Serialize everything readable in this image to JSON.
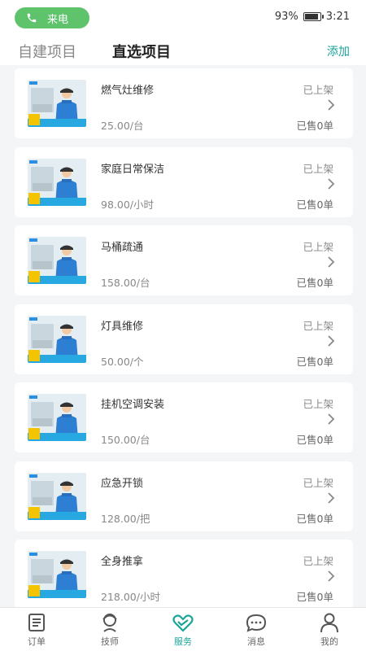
{
  "status_bar": {
    "call_label": "来电",
    "battery_text": "93%",
    "battery_level": 0.93,
    "time": "3:21"
  },
  "tabs": {
    "self_built": "自建项目",
    "selected": "直选项目",
    "add": "添加"
  },
  "services": [
    {
      "name": "燃气灶维修",
      "price": "25.00/台",
      "status": "已上架",
      "sold": "已售0单",
      "thumb_icon": "gas-stove-repair-thumbnail"
    },
    {
      "name": "家庭日常保洁",
      "price": "98.00/小时",
      "status": "已上架",
      "sold": "已售0单",
      "thumb_icon": "home-cleaning-thumbnail"
    },
    {
      "name": "马桶疏通",
      "price": "158.00/台",
      "status": "已上架",
      "sold": "已售0单",
      "thumb_icon": "toilet-unclog-thumbnail"
    },
    {
      "name": "灯具维修",
      "price": "50.00/个",
      "status": "已上架",
      "sold": "已售0单",
      "thumb_icon": "lamp-repair-thumbnail"
    },
    {
      "name": "挂机空调安装",
      "price": "150.00/台",
      "status": "已上架",
      "sold": "已售0单",
      "thumb_icon": "ac-install-thumbnail"
    },
    {
      "name": "应急开锁",
      "price": "128.00/把",
      "status": "已上架",
      "sold": "已售0单",
      "thumb_icon": "emergency-unlock-thumbnail"
    },
    {
      "name": "全身推拿",
      "price": "218.00/小时",
      "status": "已上架",
      "sold": "已售0单",
      "thumb_icon": "massage-thumbnail"
    }
  ],
  "nav": [
    {
      "label": "订单",
      "icon": "order-icon"
    },
    {
      "label": "技师",
      "icon": "technician-icon"
    },
    {
      "label": "服务",
      "icon": "service-icon",
      "active": true
    },
    {
      "label": "消息",
      "icon": "message-icon"
    },
    {
      "label": "我的",
      "icon": "profile-icon"
    }
  ],
  "colors": {
    "accent": "#1aa59a",
    "call_green": "#5fc36b",
    "thumb_blue": "#27a8e0"
  }
}
